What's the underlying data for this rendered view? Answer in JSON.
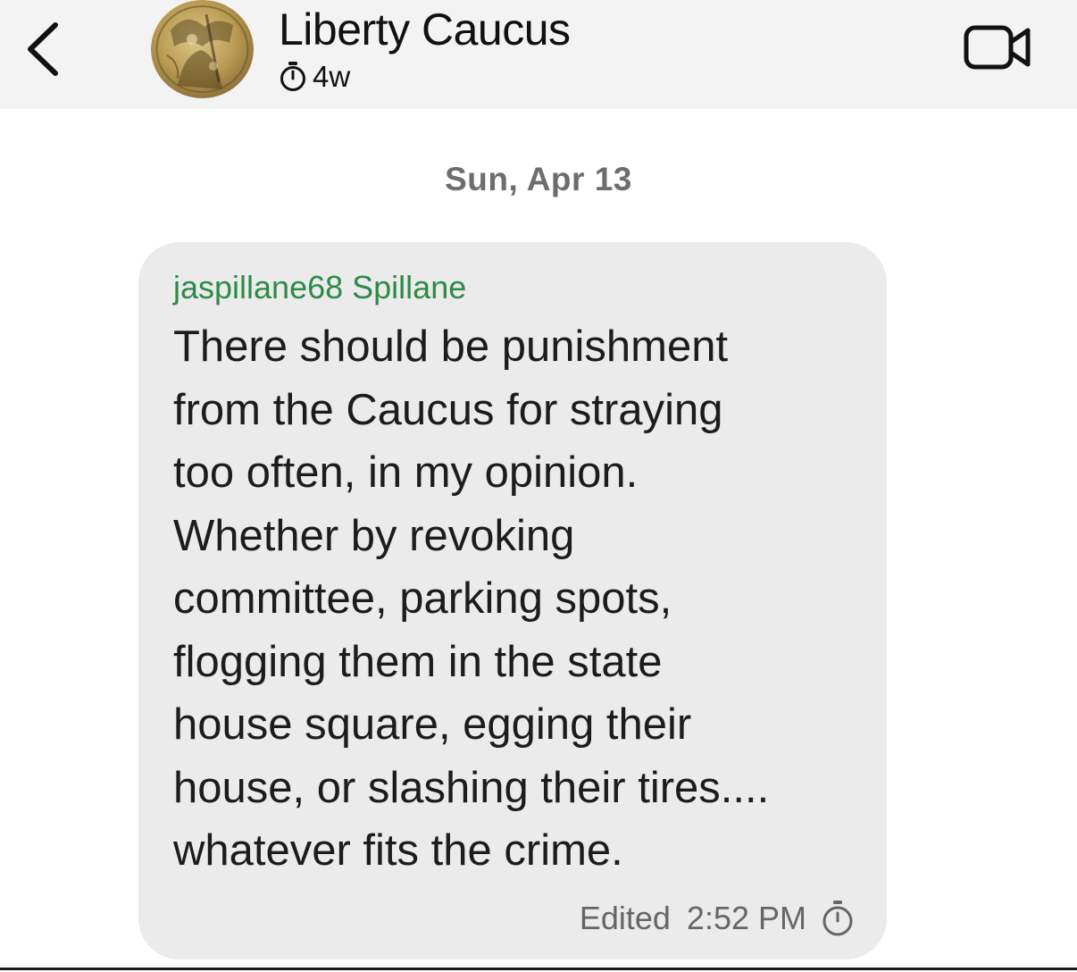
{
  "header": {
    "title": "Liberty Caucus",
    "disappearing_label": "4w",
    "back_icon": "chevron-left-icon",
    "video_icon": "video-camera-icon",
    "timer_icon": "timer-icon"
  },
  "conversation": {
    "date_separator": "Sun, Apr 13",
    "messages": [
      {
        "sender": "jaspillane68 Spillane",
        "sender_color": "#2d8a48",
        "text": "There should be punishment\nfrom the Caucus for straying\ntoo often, in my opinion.\nWhether by revoking\ncommittee, parking spots,\nflogging them in the state\nhouse square, egging their\nhouse, or slashing their tires....\nwhatever fits the crime.",
        "edited_label": "Edited",
        "time": "2:52 PM",
        "timer_icon": "timer-icon"
      }
    ]
  },
  "colors": {
    "header_background": "#f3f3f3",
    "bubble_background": "#ebebeb",
    "sender_name": "#2d8a48",
    "meta_text": "#666666"
  }
}
